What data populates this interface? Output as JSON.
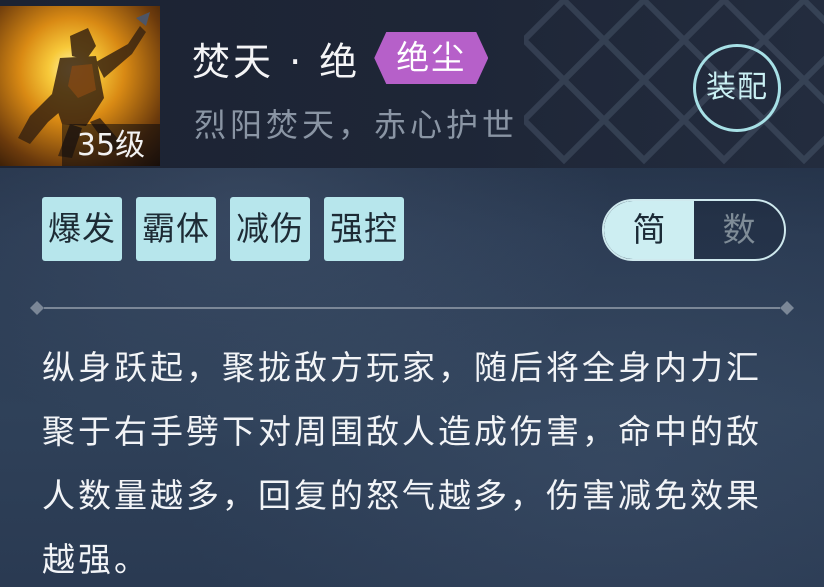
{
  "skill": {
    "level_label": "35级",
    "title": "焚天 · 绝",
    "quality_badge": "绝尘",
    "subtitle": "烈阳焚天，赤心护世",
    "equip_label": "装配"
  },
  "tags": [
    "爆发",
    "霸体",
    "减伤",
    "强控"
  ],
  "mode_toggle": {
    "active_label": "简",
    "inactive_label": "数"
  },
  "description": "纵身跃起，聚拢敌方玩家，随后将全身内力汇聚于右手劈下对周围敌人造成伤害，命中的敌人数量越多，回复的怒气越多，伤害减免效果越强。",
  "colors": {
    "tag_bg": "#b7e6ec",
    "badge_purple": "#b660c9",
    "accent_cyan": "#a7e0e6",
    "background": "#2a3a52"
  }
}
